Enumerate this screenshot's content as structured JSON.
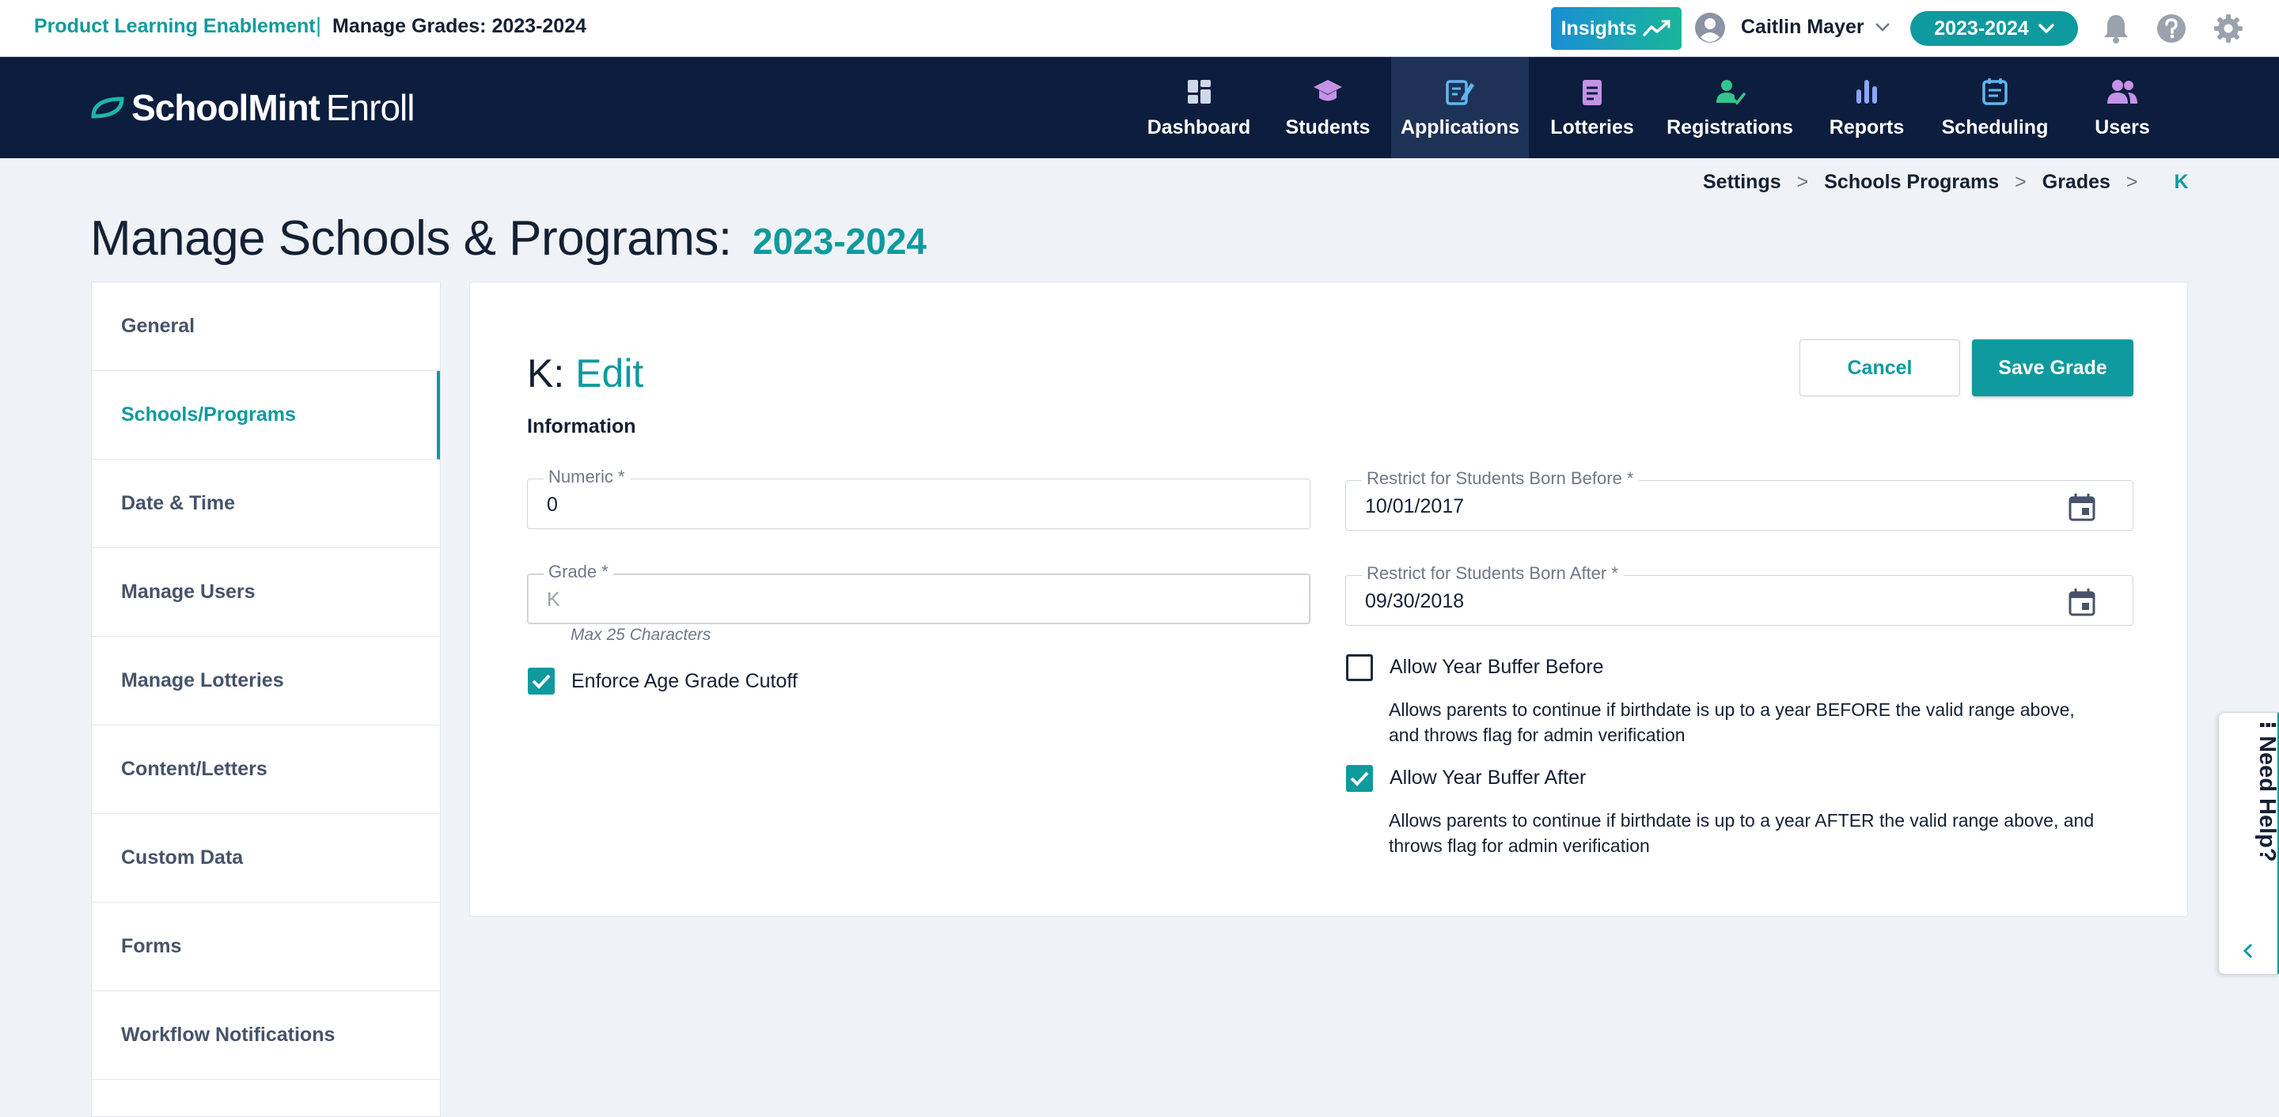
{
  "topbar": {
    "org": "Product Learning Enablement",
    "separator": "|",
    "page": "Manage Grades: 2023-2024",
    "insights_label": "Insights",
    "user_name": "Caitlin Mayer",
    "year": "2023-2024"
  },
  "brand": {
    "bold": "SchoolMint",
    "thin": "Enroll"
  },
  "nav": {
    "items": [
      {
        "label": "Dashboard",
        "icon": "dashboard-icon"
      },
      {
        "label": "Students",
        "icon": "graduation-cap-icon"
      },
      {
        "label": "Applications",
        "icon": "edit-document-icon",
        "active": true
      },
      {
        "label": "Lotteries",
        "icon": "clipboard-icon"
      },
      {
        "label": "Registrations",
        "icon": "user-check-icon"
      },
      {
        "label": "Reports",
        "icon": "bar-chart-icon"
      },
      {
        "label": "Scheduling",
        "icon": "calendar-list-icon"
      },
      {
        "label": "Users",
        "icon": "users-icon"
      }
    ]
  },
  "breadcrumb": {
    "items": [
      "Settings",
      "Schools Programs",
      "Grades"
    ],
    "separator": ">",
    "current": "K"
  },
  "page": {
    "title": "Manage Schools & Programs:",
    "year": "2023-2024"
  },
  "sidebar": {
    "items": [
      {
        "label": "General"
      },
      {
        "label": "Schools/Programs",
        "active": true
      },
      {
        "label": "Date & Time"
      },
      {
        "label": "Manage Users"
      },
      {
        "label": "Manage Lotteries"
      },
      {
        "label": "Content/Letters"
      },
      {
        "label": "Custom Data"
      },
      {
        "label": "Forms"
      },
      {
        "label": "Workflow Notifications"
      }
    ]
  },
  "form": {
    "title_prefix": "K:",
    "title_action": "Edit",
    "cancel_label": "Cancel",
    "save_label": "Save Grade",
    "section": "Information",
    "numeric": {
      "label": "Numeric *",
      "value": "0"
    },
    "grade": {
      "label": "Grade *",
      "value": "K",
      "hint": "Max 25 Characters"
    },
    "born_before": {
      "label": "Restrict for Students Born Before *",
      "value": "10/01/2017"
    },
    "born_after": {
      "label": "Restrict for Students Born After *",
      "value": "09/30/2018"
    },
    "enforce_cutoff": {
      "label": "Enforce Age Grade Cutoff",
      "checked": true
    },
    "buffer_before": {
      "label": "Allow Year Buffer Before",
      "checked": false,
      "description": "Allows parents to continue if birthdate is up to a year BEFORE the valid range above, and throws flag for admin verification"
    },
    "buffer_after": {
      "label": "Allow Year Buffer After",
      "checked": true,
      "description": "Allows parents to continue if birthdate is up to a year AFTER the valid range above, and throws flag for admin verification"
    }
  },
  "help_tab": {
    "label": "Need Help?"
  },
  "colors": {
    "accent": "#0e9a9e",
    "navy": "#0c1d3e",
    "nav_active": "#1e3257",
    "background": "#eff3f8"
  }
}
